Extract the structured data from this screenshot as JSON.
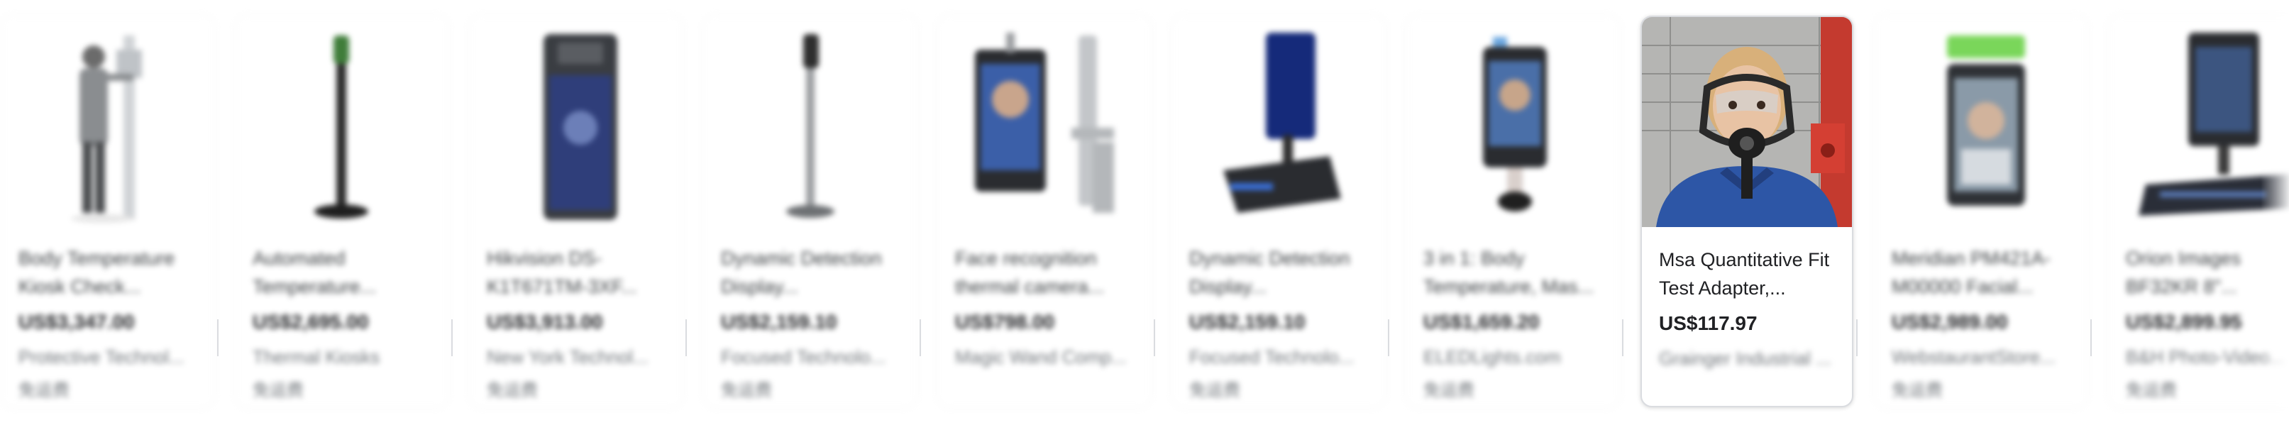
{
  "carousel": {
    "items": [
      {
        "title": "Body Temperature Kiosk Check...",
        "price": "US$3,347.00",
        "store": "Protective Technol...",
        "shipping": "免运费",
        "image": "person-kiosk"
      },
      {
        "title": "Automated Temperature...",
        "price": "US$2,695.00",
        "store": "Thermal Kiosks",
        "shipping": "免运费",
        "image": "pole-stand"
      },
      {
        "title": "Hikvision DS-K1T671TM-3XF...",
        "price": "US$3,913.00",
        "store": "New York Technol...",
        "shipping": "免运费",
        "image": "tablet-terminal"
      },
      {
        "title": "Dynamic Detection Display...",
        "price": "US$2,159.10",
        "store": "Focused Technolo...",
        "shipping": "免运费",
        "image": "pole-stand-grey"
      },
      {
        "title": "Face recognition thermal camera...",
        "price": "US$798.00",
        "store": "Magic Wand Comp...",
        "shipping": "",
        "image": "face-terminal"
      },
      {
        "title": "Dynamic Detection Display...",
        "price": "US$2,159.10",
        "store": "Focused Technolo...",
        "shipping": "免运费",
        "image": "desk-terminal"
      },
      {
        "title": "3 in 1: Body Temperature, Mas...",
        "price": "US$1,659.20",
        "store": "ELEDLights.com",
        "shipping": "免运费",
        "image": "face-terminal-small"
      },
      {
        "title": "Msa Quantitative Fit Test Adapter,...",
        "price": "US$117.97",
        "store": "Grainger Industrial ...",
        "shipping": "",
        "image": "gas-mask-person"
      },
      {
        "title": "Meridian PM421A-M00000 Facial...",
        "price": "US$2,989.00",
        "store": "WebstaurantStore...",
        "shipping": "免运费",
        "image": "facial-terminal-green"
      },
      {
        "title": "Orion Images BF32KR 8\"...",
        "price": "US$2,899.95",
        "store": "B&H Photo-Video...",
        "shipping": "免运费",
        "image": "desk-terminal-dark"
      }
    ]
  }
}
